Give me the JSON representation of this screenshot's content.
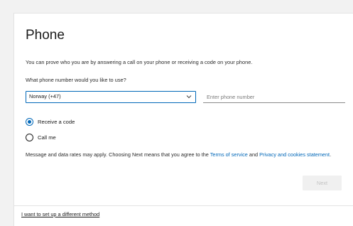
{
  "page": {
    "title": "Phone",
    "description": "You can prove who you are by answering a call on your phone or receiving a code on your phone.",
    "question": "What phone number would you like to use?"
  },
  "form": {
    "country_value": "Norway (+47)",
    "phone_placeholder": "Enter phone number",
    "options": [
      {
        "label": "Receive a code",
        "selected": true
      },
      {
        "label": "Call me",
        "selected": false
      }
    ]
  },
  "legal": {
    "prefix": "Message and data rates may apply. Choosing Next means that you agree to the ",
    "terms_link": "Terms of service",
    "and_text": " and ",
    "privacy_link": "Privacy and cookies statement",
    "suffix": "."
  },
  "actions": {
    "next_label": "Next",
    "alt_method_link": "I want to set up a different method"
  },
  "colors": {
    "accent": "#0067b8",
    "background": "#f2f2f2",
    "card": "#ffffff"
  },
  "icons": {
    "select_chevron": "chevron-down-icon"
  }
}
